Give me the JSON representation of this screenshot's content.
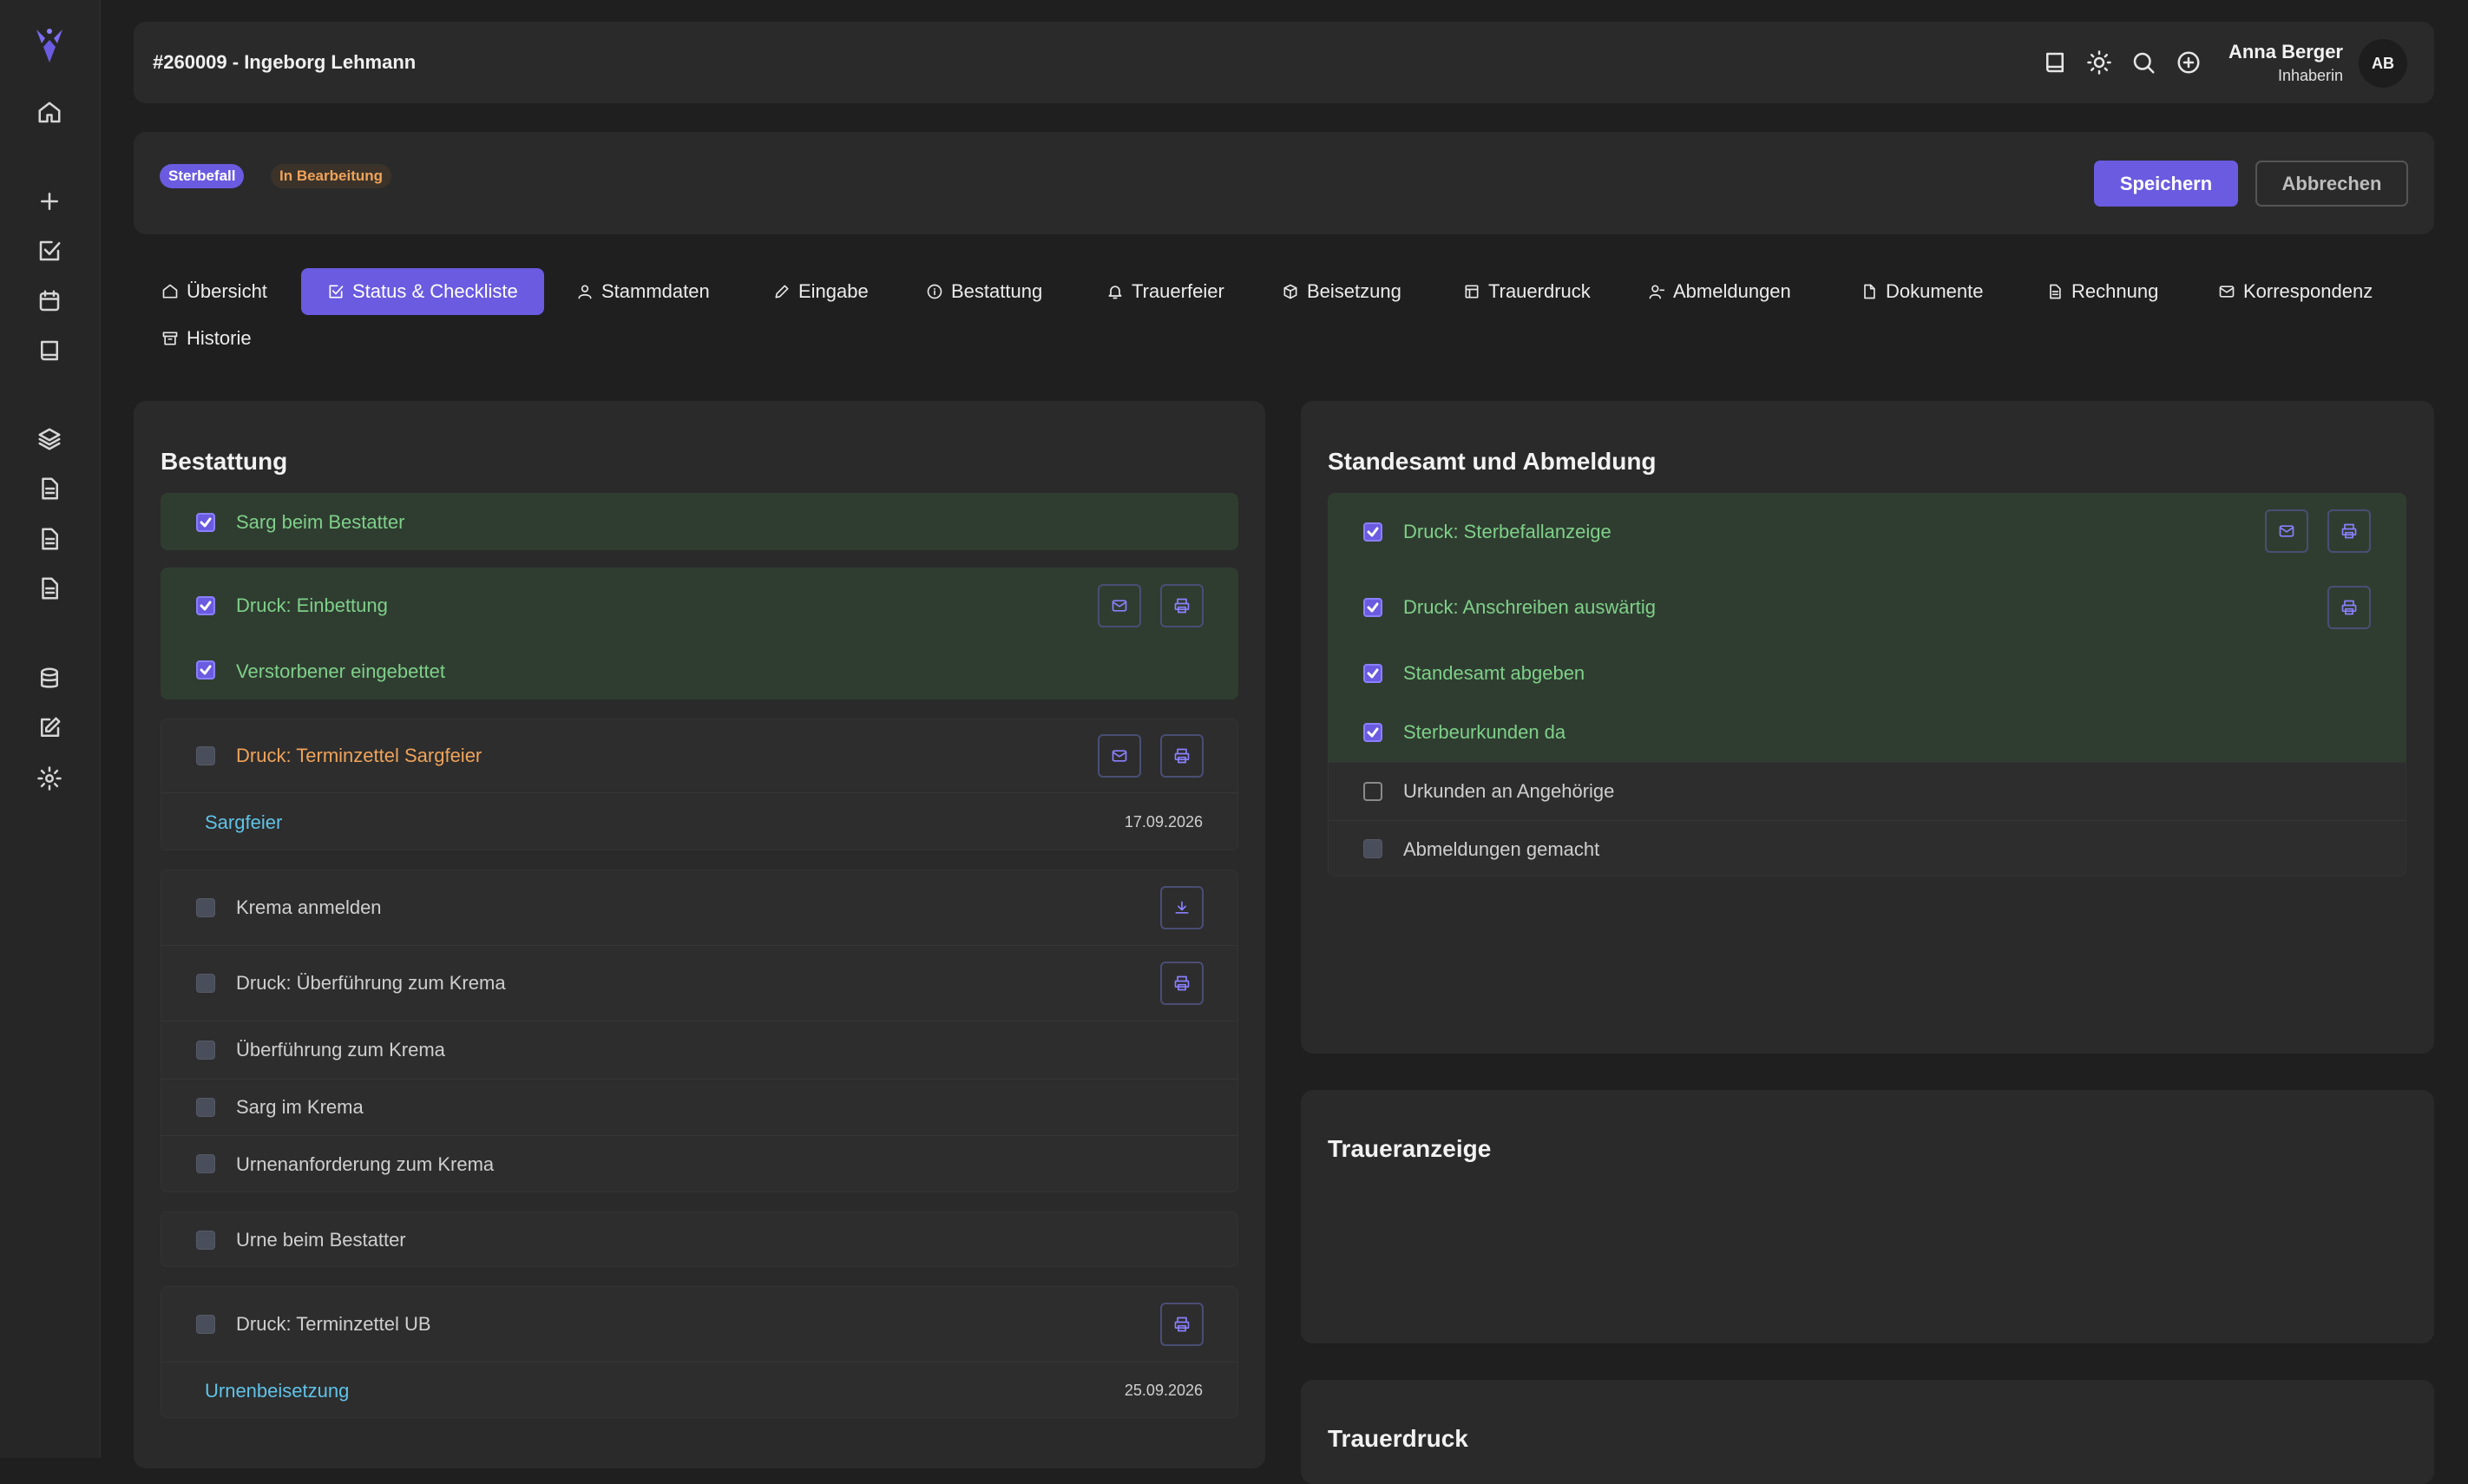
{
  "header": {
    "case_title": "#260009 - Ingeborg Lehmann",
    "user_name": "Anna Berger",
    "user_role": "Inhaberin",
    "avatar_initials": "AB"
  },
  "status": {
    "badge_type": "Sterbefall",
    "badge_state": "In Bearbeitung",
    "save_label": "Speichern",
    "cancel_label": "Abbrechen"
  },
  "tabs": [
    {
      "label": "Übersicht",
      "icon": "home-icon"
    },
    {
      "label": "Status & Checkliste",
      "icon": "checklist-icon",
      "active": true
    },
    {
      "label": "Stammdaten",
      "icon": "user-icon"
    },
    {
      "label": "Eingabe",
      "icon": "pencil-icon"
    },
    {
      "label": "Bestattung",
      "icon": "info-icon"
    },
    {
      "label": "Trauerfeier",
      "icon": "bell-icon"
    },
    {
      "label": "Beisetzung",
      "icon": "cube-icon"
    },
    {
      "label": "Trauerdruck",
      "icon": "layout-icon"
    },
    {
      "label": "Abmeldungen",
      "icon": "user-minus-icon"
    },
    {
      "label": "Dokumente",
      "icon": "file-icon"
    },
    {
      "label": "Rechnung",
      "icon": "receipt-icon"
    },
    {
      "label": "Korrespondenz",
      "icon": "mail-icon"
    },
    {
      "label": "Historie",
      "icon": "archive-icon"
    }
  ],
  "bestattung": {
    "title": "Bestattung",
    "items": [
      {
        "label": "Sarg beim Bestatter",
        "checked": true
      },
      {
        "label": "Druck: Einbettung",
        "checked": true
      },
      {
        "label": "Verstorbener eingebettet",
        "checked": true
      },
      {
        "label": "Druck: Terminzettel Sargfeier",
        "checked": false
      },
      {
        "label": "Sargfeier",
        "date": "17.09.2026"
      },
      {
        "label": "Krema anmelden",
        "checked": false
      },
      {
        "label": "Druck: Überführung zum Krema",
        "checked": false
      },
      {
        "label": "Überführung zum Krema",
        "checked": false
      },
      {
        "label": "Sarg im Krema",
        "checked": false
      },
      {
        "label": "Urnenanforderung zum Krema",
        "checked": false
      },
      {
        "label": "Urne beim Bestatter",
        "checked": false
      },
      {
        "label": "Druck: Terminzettel UB",
        "checked": false
      },
      {
        "label": "Urnenbeisetzung",
        "date": "25.09.2026"
      }
    ]
  },
  "standesamt": {
    "title": "Standesamt und Abmeldung",
    "items": [
      {
        "label": "Druck: Sterbefallanzeige",
        "checked": true
      },
      {
        "label": "Druck: Anschreiben auswärtig",
        "checked": true
      },
      {
        "label": "Standesamt abgeben",
        "checked": true
      },
      {
        "label": "Sterbeurkunden da",
        "checked": true
      },
      {
        "label": "Urkunden an Angehörige",
        "checked": false
      },
      {
        "label": "Abmeldungen gemacht",
        "checked": false
      }
    ]
  },
  "traueranzeige": {
    "title": "Traueranzeige"
  },
  "trauerdruck": {
    "title": "Trauerdruck"
  },
  "colors": {
    "accent": "#6a5be0",
    "done_bg": "#2f3d30",
    "done_text": "#7fd08a",
    "pending_text": "#f0a35a",
    "link": "#5fc3e8"
  }
}
